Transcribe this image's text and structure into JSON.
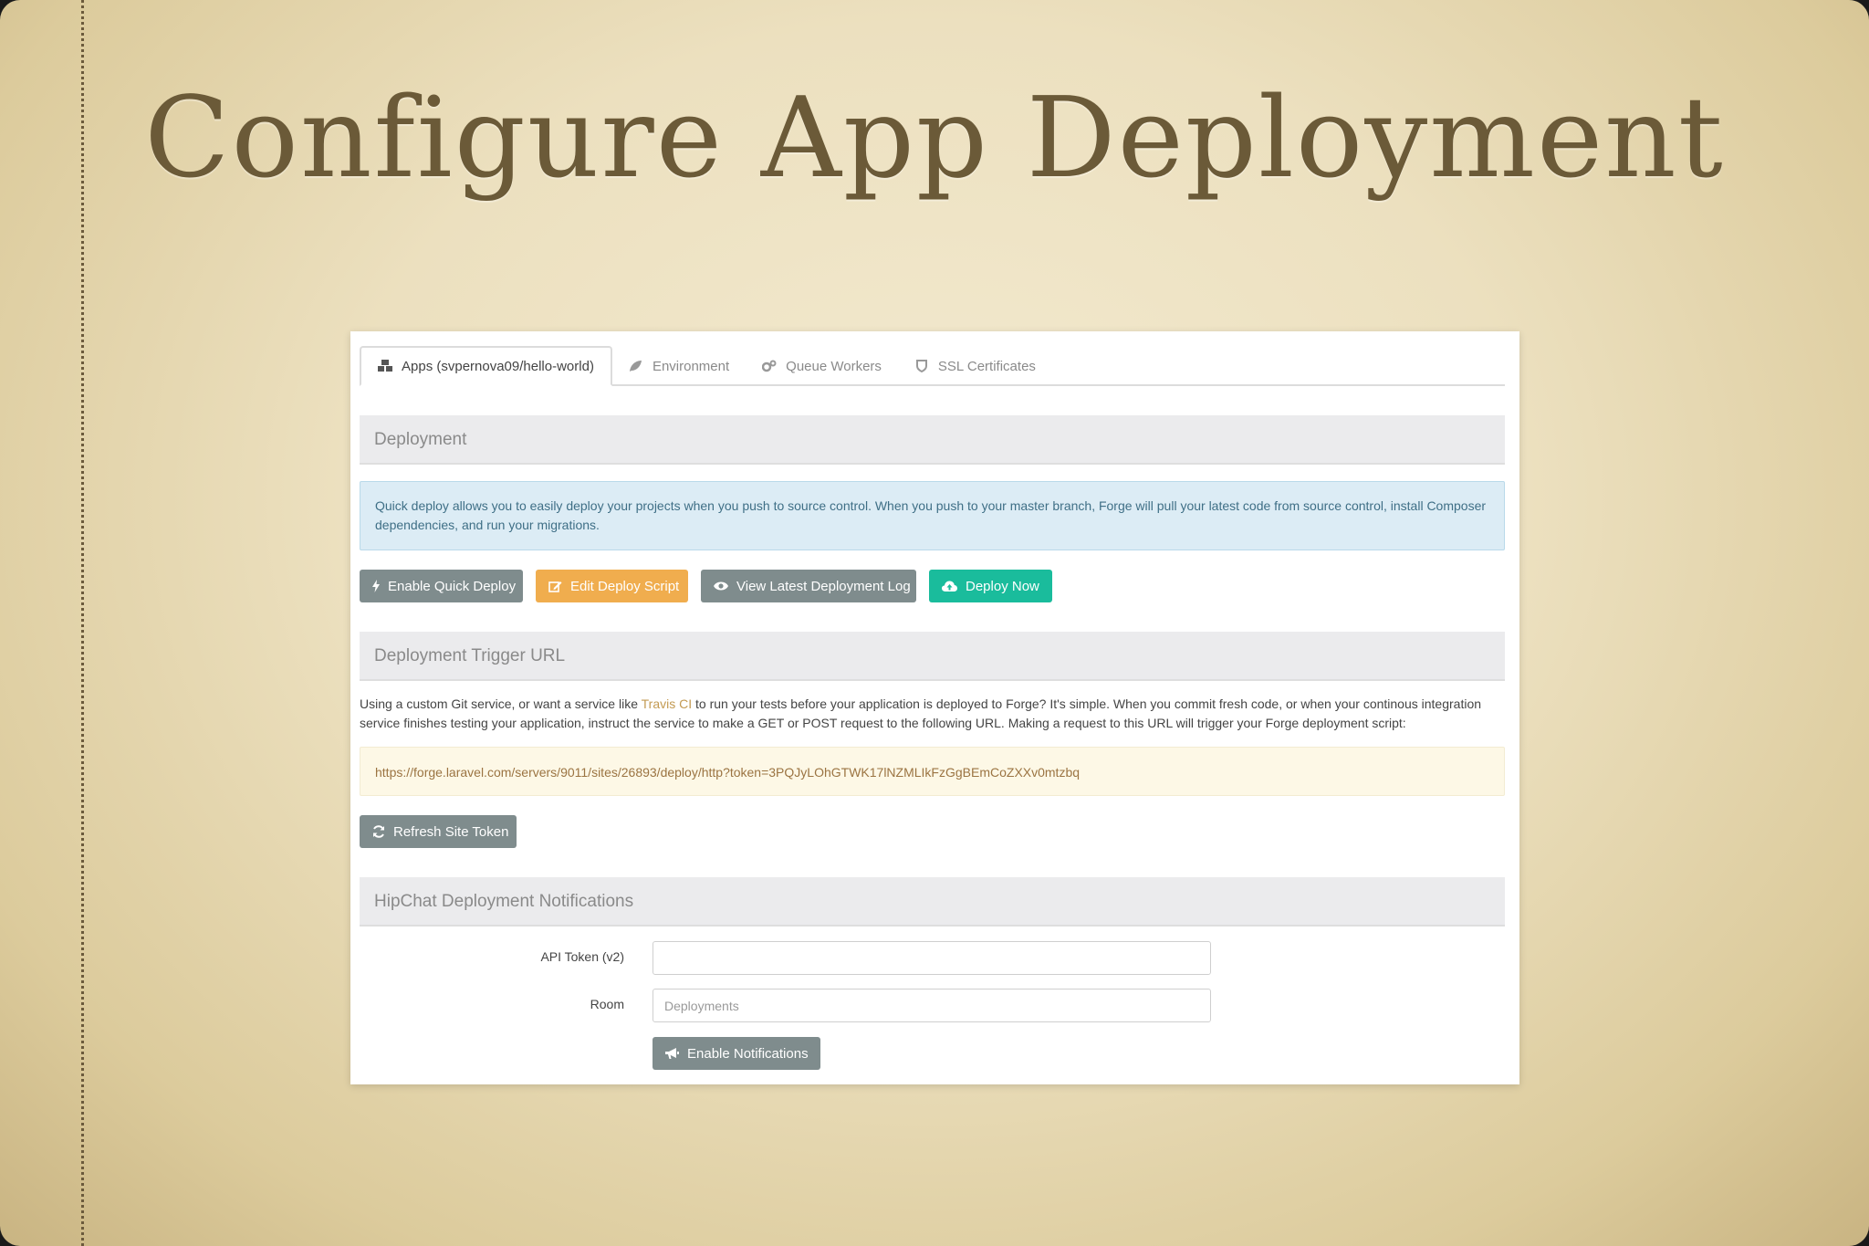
{
  "slide": {
    "title": "Configure App Deployment"
  },
  "tabs": [
    {
      "label": "Apps (svpernova09/hello-world)",
      "icon": "cubes-icon",
      "active": true
    },
    {
      "label": "Environment",
      "icon": "leaf-icon",
      "active": false
    },
    {
      "label": "Queue Workers",
      "icon": "gears-icon",
      "active": false
    },
    {
      "label": "SSL Certificates",
      "icon": "shield-icon",
      "active": false
    }
  ],
  "deployment": {
    "heading": "Deployment",
    "info": "Quick deploy allows you to easily deploy your projects when you push to source control. When you push to your master branch, Forge will pull your latest code from source control, install Composer dependencies, and run your migrations.",
    "buttons": {
      "quick_deploy": "Enable Quick Deploy",
      "edit_script": "Edit Deploy Script",
      "view_log": "View Latest Deployment Log",
      "deploy_now": "Deploy Now"
    }
  },
  "trigger": {
    "heading": "Deployment Trigger URL",
    "desc_before": "Using a custom Git service, or want a service like ",
    "desc_link": "Travis CI",
    "desc_after": " to run your tests before your application is deployed to Forge? It's simple. When you commit fresh code, or when your continous integration service finishes testing your application, instruct the service to make a GET or POST request to the following URL. Making a request to this URL will trigger your Forge deployment script:",
    "url": "https://forge.laravel.com/servers/9011/sites/26893/deploy/http?token=3PQJyLOhGTWK17lNZMLIkFzGgBEmCoZXXv0mtzbq",
    "refresh_label": "Refresh Site Token"
  },
  "hipchat": {
    "heading": "HipChat Deployment Notifications",
    "api_token_label": "API Token (v2)",
    "api_token_value": "",
    "room_label": "Room",
    "room_placeholder": "Deployments",
    "enable_label": "Enable Notifications"
  },
  "colors": {
    "gray_button": "#7f8c8d",
    "orange_button": "#f0ad4e",
    "teal_button": "#1abc9c",
    "info_bg": "#dcecf5",
    "url_bg": "#fdf8e6"
  }
}
